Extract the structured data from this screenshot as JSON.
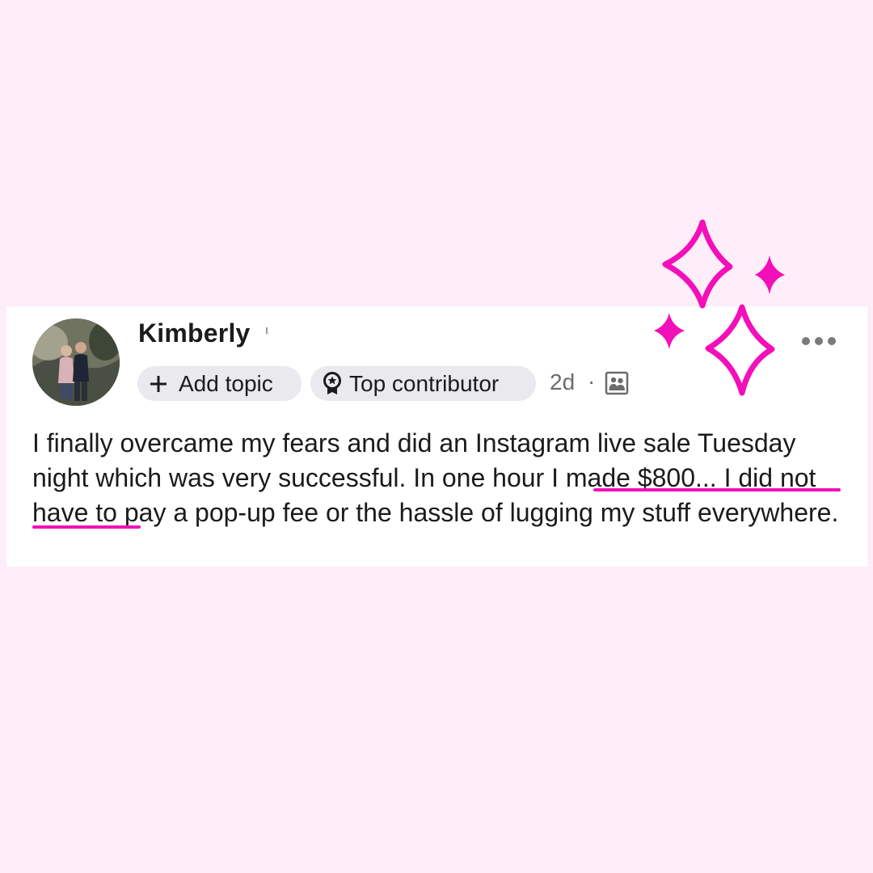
{
  "post": {
    "author_name": "Kimberly",
    "add_topic_label": "Add topic",
    "top_contributor_label": "Top contributor",
    "timestamp": "2d",
    "separator": "·",
    "body_text": "I finally overcame my fears and did an Instagram live sale Tuesday night which was very successful. In one hour I made $800... I did not have to pay a pop-up fee or the hassle of lugging my stuff everywhere."
  },
  "icons": {
    "add": "plus-icon",
    "badge": "top-contributor-badge-icon",
    "audience": "audience-group-icon",
    "more": "more-options-icon",
    "decoration": "sparkles-icon"
  },
  "colors": {
    "background": "#fdeef9",
    "accent": "#f30fb9",
    "chip": "#e9e9ee",
    "text": "#1b1b1b",
    "meta": "#6b6b6b"
  }
}
